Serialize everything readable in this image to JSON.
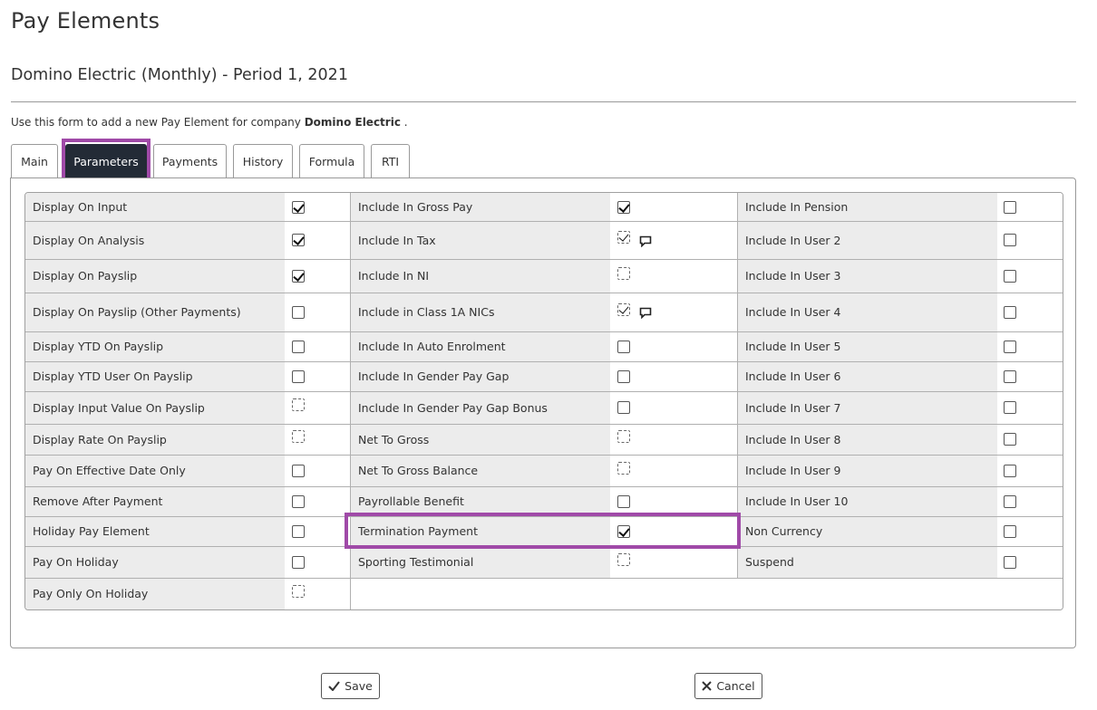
{
  "page": {
    "title": "Pay Elements",
    "subtitle": "Domino Electric (Monthly) - Period 1, 2021",
    "intro_prefix": "Use this form to add a new Pay Element for company",
    "intro_company": "Domino Electric",
    "intro_suffix": "."
  },
  "tabs": [
    {
      "label": "Main"
    },
    {
      "label": "Parameters",
      "active": true
    },
    {
      "label": "Payments"
    },
    {
      "label": "History"
    },
    {
      "label": "Formula"
    },
    {
      "label": "RTI"
    }
  ],
  "parameters": {
    "rows": [
      [
        {
          "label": "Display On Input",
          "state": "checked"
        },
        {
          "label": "Include In Gross Pay",
          "state": "checked"
        },
        {
          "label": "Include In Pension",
          "state": "unchecked"
        }
      ],
      [
        {
          "label": "Display On Analysis",
          "state": "checked"
        },
        {
          "label": "Include In Tax",
          "state": "checked-disabled",
          "comment": "comment-icon"
        },
        {
          "label": "Include In User 2",
          "state": "unchecked"
        }
      ],
      [
        {
          "label": "Display On Payslip",
          "state": "checked"
        },
        {
          "label": "Include In NI",
          "state": "disabled"
        },
        {
          "label": "Include In User 3",
          "state": "unchecked"
        }
      ],
      [
        {
          "label": "Display On Payslip (Other Payments)",
          "state": "unchecked"
        },
        {
          "label": "Include in Class 1A NICs",
          "state": "checked-disabled",
          "comment": "comment-icon"
        },
        {
          "label": "Include In User 4",
          "state": "unchecked"
        }
      ],
      [
        {
          "label": "Display YTD On Payslip",
          "state": "unchecked"
        },
        {
          "label": "Include In Auto Enrolment",
          "state": "unchecked"
        },
        {
          "label": "Include In User 5",
          "state": "unchecked"
        }
      ],
      [
        {
          "label": "Display YTD User On Payslip",
          "state": "unchecked"
        },
        {
          "label": "Include In Gender Pay Gap",
          "state": "unchecked"
        },
        {
          "label": "Include In User 6",
          "state": "unchecked"
        }
      ],
      [
        {
          "label": "Display Input Value On Payslip",
          "state": "disabled"
        },
        {
          "label": "Include In Gender Pay Gap Bonus",
          "state": "unchecked"
        },
        {
          "label": "Include In User 7",
          "state": "unchecked"
        }
      ],
      [
        {
          "label": "Display Rate On Payslip",
          "state": "disabled"
        },
        {
          "label": "Net To Gross",
          "state": "disabled"
        },
        {
          "label": "Include In User 8",
          "state": "unchecked"
        }
      ],
      [
        {
          "label": "Pay On Effective Date Only",
          "state": "unchecked"
        },
        {
          "label": "Net To Gross Balance",
          "state": "disabled"
        },
        {
          "label": "Include In User 9",
          "state": "unchecked"
        }
      ],
      [
        {
          "label": "Remove After Payment",
          "state": "unchecked"
        },
        {
          "label": "Payrollable Benefit",
          "state": "unchecked"
        },
        {
          "label": "Include In User 10",
          "state": "unchecked"
        }
      ],
      [
        {
          "label": "Holiday Pay Element",
          "state": "unchecked"
        },
        {
          "label": "Termination Payment",
          "state": "checked"
        },
        {
          "label": "Non Currency",
          "state": "unchecked"
        }
      ],
      [
        {
          "label": "Pay On Holiday",
          "state": "unchecked"
        },
        {
          "label": "Sporting Testimonial",
          "state": "disabled"
        },
        {
          "label": "Suspend",
          "state": "unchecked"
        }
      ],
      [
        {
          "label": "Pay Only On Holiday",
          "state": "disabled"
        }
      ]
    ]
  },
  "actions": {
    "save_label": "Save",
    "save_icon": "check-icon",
    "cancel_label": "Cancel",
    "cancel_icon": "close-icon"
  },
  "colors": {
    "active_tab": "#232b36",
    "highlight": "#a04aa8",
    "label_bg": "#ececec"
  }
}
